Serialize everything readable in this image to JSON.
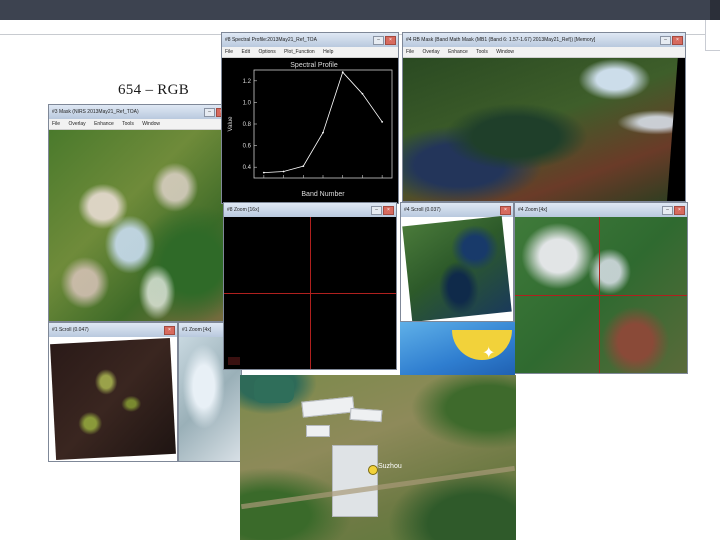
{
  "slide": {
    "title": "654 – RGB"
  },
  "windows": {
    "mask_main": {
      "title": "#3 Mask (NIRS 2013May21_Ref_TOA)",
      "menu": [
        "File",
        "Overlay",
        "Enhance",
        "Tools",
        "Window"
      ]
    },
    "spectral": {
      "title": "#8 Spectral Profile:2013May21_Ref_TOA",
      "menu": [
        "File",
        "Edit",
        "Options",
        "Plot_Function",
        "Help"
      ],
      "chart_data": {
        "type": "line",
        "title": "Spectral Profile",
        "xlabel": "Band Number",
        "ylabel": "Value",
        "ylim": [
          0.3,
          1.3
        ],
        "x": [
          1,
          2,
          3,
          4,
          5,
          6,
          7
        ],
        "y": [
          0.35,
          0.36,
          0.41,
          0.72,
          1.28,
          1.08,
          0.82
        ],
        "y_ticks": [
          "0.4",
          "0.6",
          "0.8",
          "1.0",
          "1.2"
        ],
        "line_color": "#ffffff",
        "background": "#000000"
      }
    },
    "mask_right": {
      "title": "#4 RB Mask (Band Math Mask (MB1 (Band 6: 1.57-1.67) 2013May21_Ref)) [Memory]",
      "menu": [
        "File",
        "Overlay",
        "Enhance",
        "Tools",
        "Window"
      ]
    },
    "zoom8": {
      "title": "#8 Zoom [16x]"
    },
    "scroll4": {
      "title": "#4 Scroll (0.037)"
    },
    "zoom4": {
      "title": "#4 Zoom [4x]"
    },
    "scroll1": {
      "title": "#1 Scroll (0.047)"
    },
    "zoom1": {
      "title": "#1 Zoom [4x]"
    }
  },
  "aerial": {
    "label": "Suzhou"
  },
  "colors": {
    "topbar": "#3d4350",
    "crosshair": "#b0201e",
    "titlebar_close": "#d76a5e"
  }
}
